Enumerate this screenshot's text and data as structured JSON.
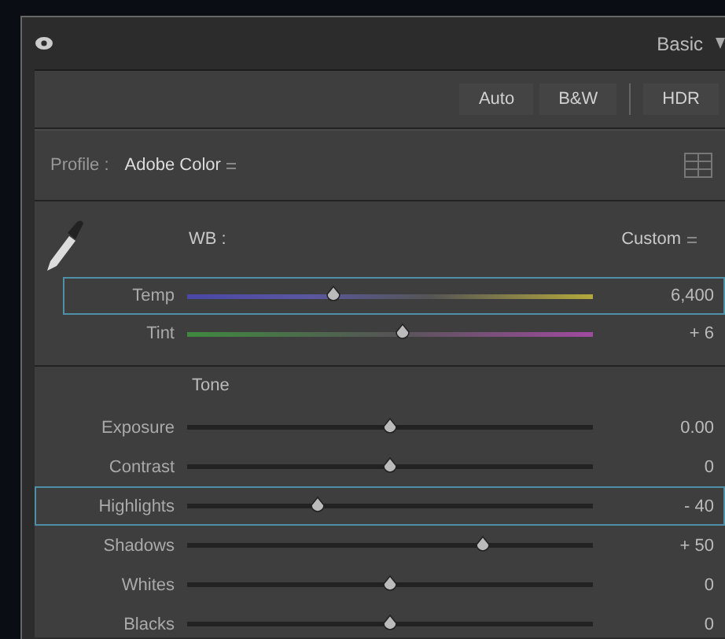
{
  "panel": {
    "title": "Basic"
  },
  "treatment_buttons": [
    {
      "label": "Auto"
    },
    {
      "label": "B&W"
    },
    {
      "label": "HDR"
    }
  ],
  "profile": {
    "label": "Profile :",
    "value": "Adobe Color"
  },
  "white_balance": {
    "label": "WB :",
    "value": "Custom",
    "sliders": [
      {
        "label": "Temp",
        "kind": "temp",
        "level": 0.36,
        "value": "6,400",
        "highlighted": true
      },
      {
        "label": "Tint",
        "kind": "tint",
        "level": 0.53,
        "value": "+ 6",
        "highlighted": false
      }
    ]
  },
  "tone": {
    "label": "Tone",
    "sliders": [
      {
        "label": "Exposure",
        "kind": "plain",
        "level": 0.5,
        "value": "0.00",
        "highlighted": false
      },
      {
        "label": "Contrast",
        "kind": "plain",
        "level": 0.5,
        "value": "0",
        "highlighted": false
      },
      {
        "label": "Highlights",
        "kind": "plain",
        "level": 0.32,
        "value": "- 40",
        "highlighted": true
      },
      {
        "label": "Shadows",
        "kind": "plain",
        "level": 0.73,
        "value": "+ 50",
        "highlighted": false
      },
      {
        "label": "Whites",
        "kind": "plain",
        "level": 0.5,
        "value": "0",
        "highlighted": false
      },
      {
        "label": "Blacks",
        "kind": "plain",
        "level": 0.5,
        "value": "0",
        "highlighted": false
      }
    ]
  }
}
